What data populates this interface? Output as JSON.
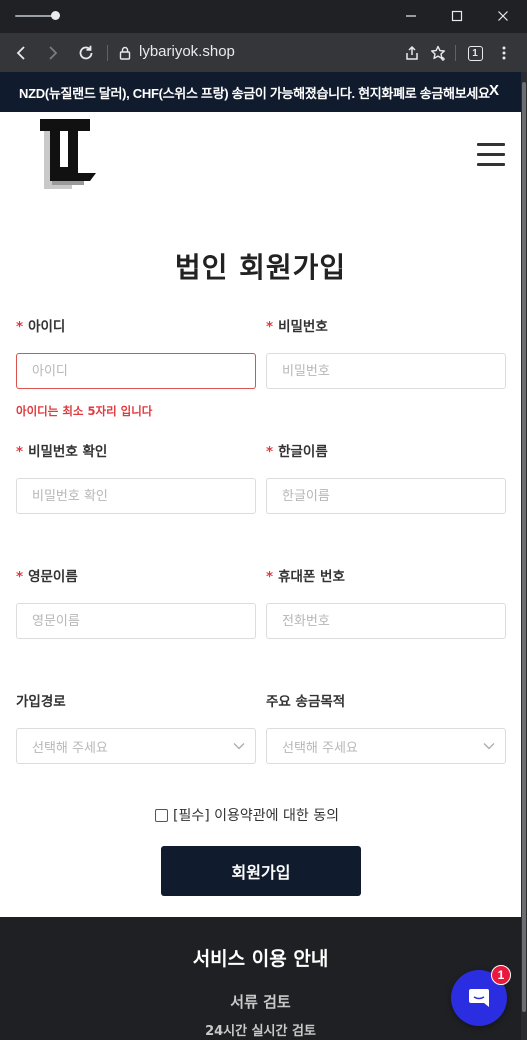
{
  "browser": {
    "url": "lybariyok.shop",
    "tab_count": "1"
  },
  "notice": {
    "text": "NZD(뉴질랜드 달러), CHF(스위스 프랑) 송금이 가능해졌습니다. 현지화폐로 송금해보세요",
    "close": "X"
  },
  "page": {
    "title": "법인 회원가입"
  },
  "form": {
    "required_mark": "*",
    "id": {
      "label": "아이디",
      "placeholder": "아이디",
      "error": "아이디는 최소 5자리 입니다"
    },
    "password": {
      "label": "비밀번호",
      "placeholder": "비밀번호"
    },
    "password_confirm": {
      "label": "비밀번호 확인",
      "placeholder": "비밀번호 확인"
    },
    "korean_name": {
      "label": "한글이름",
      "placeholder": "한글이름"
    },
    "english_name": {
      "label": "영문이름",
      "placeholder": "영문이름"
    },
    "phone": {
      "label": "휴대폰 번호",
      "placeholder": "전화번호"
    },
    "signup_route": {
      "label": "가입경로",
      "selected": "선택해 주세요"
    },
    "remit_purpose": {
      "label": "주요 송금목적",
      "selected": "선택해 주세요"
    },
    "terms": "[필수] 이용약관에 대한 동의",
    "submit": "회원가입"
  },
  "footer": {
    "title": "서비스 이용 안내",
    "item1": "서류 검토",
    "item2": "24시간 실시간 검토"
  },
  "chat": {
    "badge": "1",
    "icon": "chat-bubble-icon"
  },
  "colors": {
    "brand_navy": "#101b2d",
    "required_red": "#e0393e",
    "chat_blue": "#2a2ee0",
    "badge_red": "#e8193c"
  }
}
